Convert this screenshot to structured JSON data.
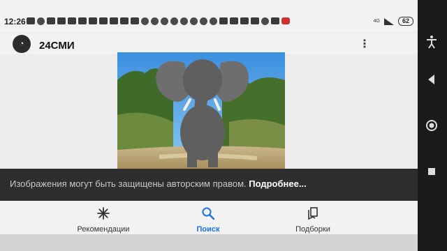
{
  "status_bar": {
    "time": "12:26",
    "network": "4G",
    "battery": "62"
  },
  "header": {
    "site_name": "24СМИ",
    "logo_alt": "site-logo"
  },
  "image": {
    "subject": "elephant"
  },
  "notice": {
    "text": "Изображения могут быть защищены авторским правом. ",
    "link": "Подробнее..."
  },
  "bottom_nav": {
    "items": [
      {
        "label": "Рекомендации",
        "icon": "asterisk-icon"
      },
      {
        "label": "Поиск",
        "icon": "search-icon"
      },
      {
        "label": "Подборки",
        "icon": "collections-icon"
      }
    ],
    "active_index": 1
  },
  "colors": {
    "accent": "#1a73e8",
    "notice_bg": "#2e2e2e",
    "screen_bg": "#ececec"
  }
}
